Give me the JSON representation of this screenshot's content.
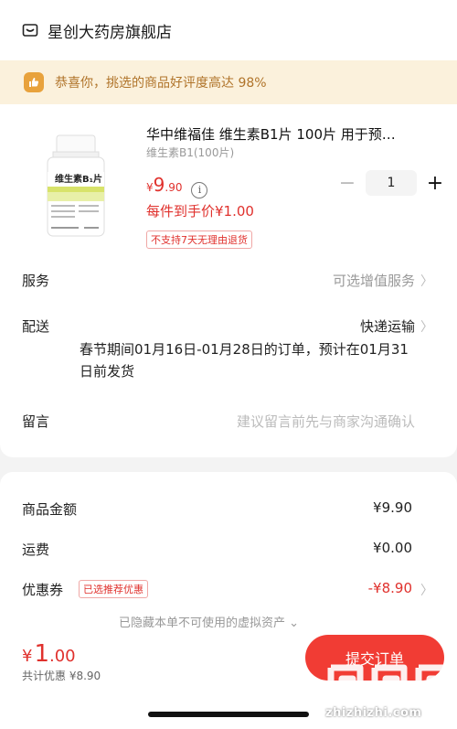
{
  "shop": {
    "name": "星创大药房旗舰店",
    "icon": "shop-icon"
  },
  "banner": {
    "text": "恭喜你，挑选的商品好评度高达 98%",
    "icon": "thumbs-up-icon"
  },
  "product": {
    "title": "华中维福佳 维生素B1片 100片 用于预…",
    "spec": "维生素B1(100片)",
    "image_label": "维生素B₁片",
    "price_yen": "¥",
    "price_int": "9",
    "price_dec": ".90",
    "unit_price": "每件到手价¥1.00",
    "no_return_tag": "不支持7天无理由退货",
    "quantity": "1",
    "minus": "−",
    "plus": "+"
  },
  "rows": {
    "service": {
      "label": "服务",
      "value": "可选增值服务"
    },
    "delivery": {
      "label": "配送",
      "value": "快递运输",
      "note": "春节期间01月16日-01月28日的订单，预计在01月31日前发货"
    },
    "message": {
      "label": "留言",
      "placeholder": "建议留言前先与商家沟通确认"
    }
  },
  "summary": {
    "goods_label": "商品金额",
    "goods_value": "¥9.90",
    "shipping_label": "运费",
    "shipping_value": "¥0.00",
    "coupon_label": "优惠券",
    "coupon_tag": "已选推荐优惠",
    "coupon_value": "-¥8.90",
    "hidden_assets": "已隐藏本单不可使用的虚拟资产 ⌄"
  },
  "footer": {
    "total_yen": "¥",
    "total_int": "1",
    "total_dec": ".00",
    "total_discount": "共计优惠 ¥8.90",
    "submit": "提交订单"
  },
  "watermark": {
    "text": "zhizhizhi.com"
  },
  "colors": {
    "accent": "#e0312d",
    "banner_bg": "#fbf1dc",
    "banner_text": "#b0742a",
    "submit_bg": "#f13c34"
  }
}
